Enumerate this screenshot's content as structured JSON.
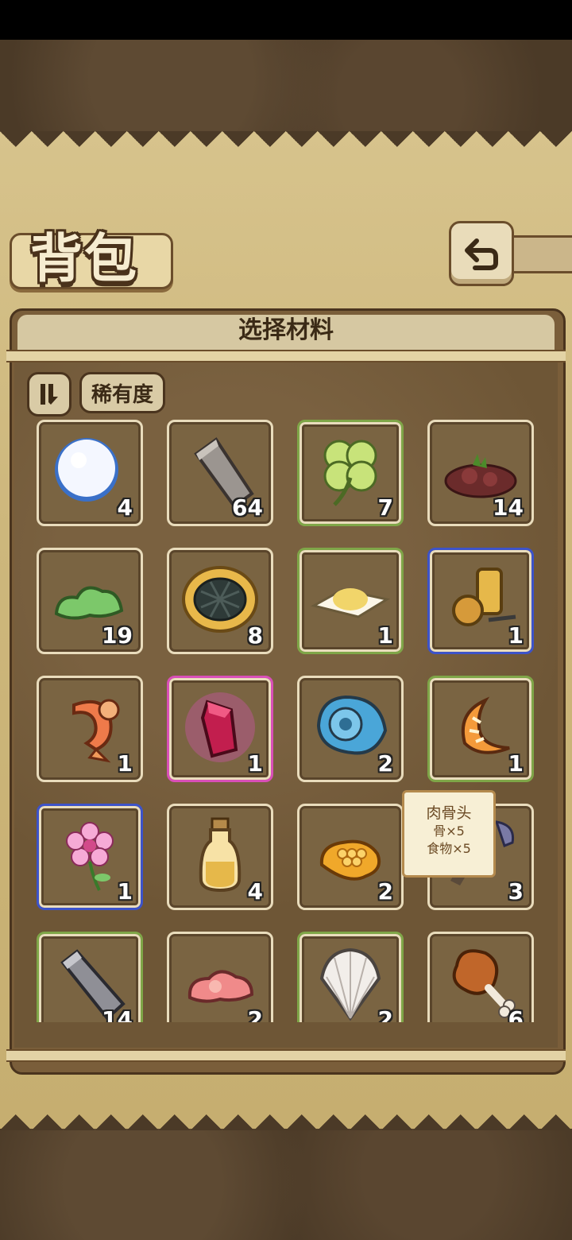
{
  "header": {
    "title": "背包"
  },
  "panel": {
    "title": "选择材料",
    "sort_label": "稀有度"
  },
  "items": [
    {
      "name": "雪球",
      "count": "4",
      "rarity": "common",
      "icon": "snowball-icon"
    },
    {
      "name": "石材",
      "count": "64",
      "rarity": "common",
      "icon": "stone-slab-icon"
    },
    {
      "name": "四叶草",
      "count": "7",
      "rarity": "green",
      "icon": "clover-icon"
    },
    {
      "name": "泥土",
      "count": "14",
      "rarity": "common",
      "icon": "dirt-pile-icon"
    },
    {
      "name": "苔藓",
      "count": "19",
      "rarity": "common",
      "icon": "moss-icon"
    },
    {
      "name": "海苔饼",
      "count": "8",
      "rarity": "common",
      "icon": "seaweed-cracker-icon"
    },
    {
      "name": "盐",
      "count": "1",
      "rarity": "green",
      "icon": "salt-icon"
    },
    {
      "name": "古物",
      "count": "1",
      "rarity": "blue",
      "icon": "treasure-icon"
    },
    {
      "name": "虾",
      "count": "1",
      "rarity": "common",
      "icon": "shrimp-icon"
    },
    {
      "name": "红宝石",
      "count": "1",
      "rarity": "pink",
      "icon": "ruby-crystal-icon"
    },
    {
      "name": "贝壳",
      "count": "2",
      "rarity": "common",
      "icon": "ammonite-shell-icon"
    },
    {
      "name": "虾仁",
      "count": "1",
      "rarity": "green",
      "icon": "shrimp-meat-icon"
    },
    {
      "name": "花",
      "count": "1",
      "rarity": "blue",
      "icon": "flower-icon"
    },
    {
      "name": "油",
      "count": "4",
      "rarity": "common",
      "icon": "oil-bottle-icon"
    },
    {
      "name": "蜂巢",
      "count": "2",
      "rarity": "common",
      "icon": "honeycomb-icon"
    },
    {
      "name": "肉骨头",
      "count": "3",
      "rarity": "common",
      "icon": "bone-icon"
    },
    {
      "name": "铁锭",
      "count": "14",
      "rarity": "green",
      "icon": "iron-bar-icon"
    },
    {
      "name": "肉块",
      "count": "2",
      "rarity": "common",
      "icon": "raw-meat-icon"
    },
    {
      "name": "扇贝",
      "count": "2",
      "rarity": "green",
      "icon": "scallop-shell-icon"
    },
    {
      "name": "鸡腿",
      "count": "6",
      "rarity": "common",
      "icon": "drumstick-icon"
    }
  ],
  "tooltip": {
    "name": "肉骨头",
    "line1": "骨×5",
    "line2": "食物×5"
  }
}
